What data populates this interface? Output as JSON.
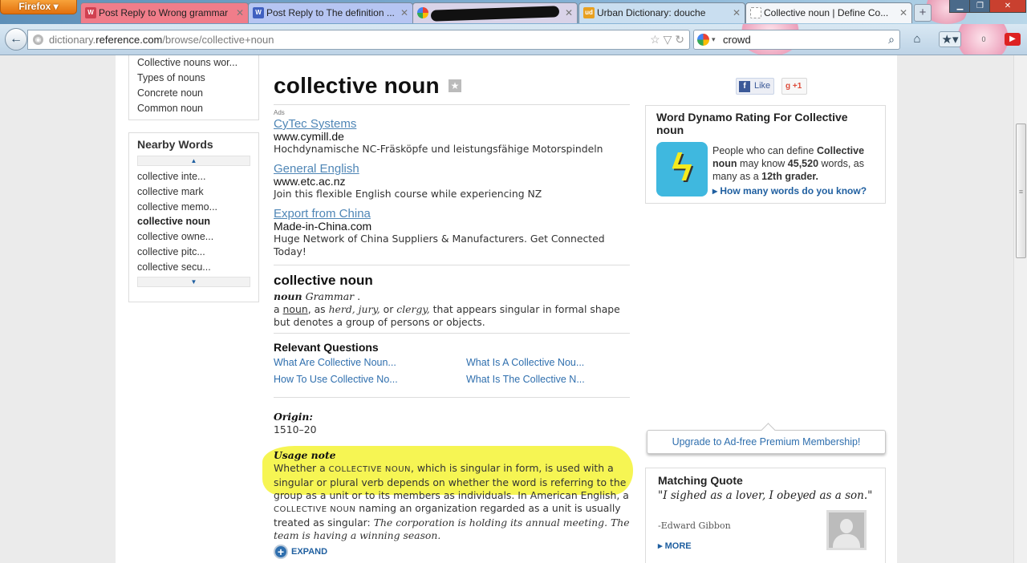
{
  "browser": {
    "app_button": "Firefox",
    "tabs": [
      {
        "icon": "W",
        "title": "Post Reply to Wrong grammar"
      },
      {
        "icon": "W",
        "title": "Post Reply to The definition ..."
      },
      {
        "icon": "",
        "title": ""
      },
      {
        "icon": "ud",
        "title": "Urban Dictionary: douche"
      },
      {
        "icon": "",
        "title": "Collective noun | Define Co..."
      }
    ],
    "url_domain": "dictionary.",
    "url_host": "reference.com",
    "url_path": "/browse/collective+noun",
    "url_prefix": "dictionary.",
    "search_value": "crowd",
    "badge_count": "0"
  },
  "sidebar": {
    "related": [
      "Collective nouns wor...",
      "Types of nouns",
      "Concrete noun",
      "Common noun"
    ],
    "nearby_title": "Nearby Words",
    "nearby": [
      "collective inte...",
      "collective mark",
      "collective memo...",
      "collective noun",
      "collective owne...",
      "collective pitc...",
      "collective secu..."
    ]
  },
  "main": {
    "headword": "collective noun",
    "ads_label": "Ads",
    "ads": [
      {
        "title": "CyTec Systems",
        "url": "www.cymill.de",
        "desc": "Hochdynamische NC-Fräsköpfe und leistungsfähige Motorspindeln"
      },
      {
        "title": "General English",
        "url": "www.etc.ac.nz",
        "desc": "Join this flexible English course while experiencing NZ"
      },
      {
        "title": "Export from China",
        "url": "Made-in-China.com",
        "desc": "Huge Network of China Suppliers & Manufacturers. Get Connected Today!"
      }
    ],
    "def_title": "collective noun",
    "pos": "noun",
    "pos_label": "Grammar",
    "def_a": "a",
    "def_link": "noun",
    "def_as": ", as",
    "def_ex1": "herd,",
    "def_ex2": "jury,",
    "def_or": "or",
    "def_ex3": "clergy,",
    "def_rest": "that appears singular in formal shape but denotes a group of persons or objects.",
    "rq_title": "Relevant Questions",
    "questions": [
      "What Are Collective Noun...",
      "What Is A Collective Nou...",
      "How To Use Collective No...",
      "What Is The Collective N..."
    ],
    "origin_label": "Origin:",
    "origin_value": "1510–20",
    "usage_label": "Usage note",
    "usage_1": "Whether a",
    "usage_sc1": "collective noun",
    "usage_2": ", which is singular in form, is used with a singular or plural verb depends on whether the word is referring to the group as a unit or to its members as individuals. In American English, a",
    "usage_sc2": "collective noun",
    "usage_3": "naming an organization regarded as a unit is usually treated as singular:",
    "usage_ex": "The corporation is holding its annual meeting. The team is having a winning season.",
    "expand": "EXPAND"
  },
  "right": {
    "like": "Like",
    "plusone": "+1",
    "dynamo_title": "Word Dynamo Rating For Collective noun",
    "dynamo_1": "People who can define",
    "dynamo_bold1": "Collective noun",
    "dynamo_2": "may know",
    "dynamo_bold2": "45,520",
    "dynamo_3": "words, as many as a",
    "dynamo_bold3": "12th grader.",
    "dynamo_link": "How many words do you know?",
    "upgrade": "Upgrade to Ad-free Premium Membership!",
    "quote_title": "Matching Quote",
    "quote": "\"I sighed as a lover, I obeyed as a son.\"",
    "quote_author": "-Edward Gibbon",
    "more": "MORE"
  }
}
